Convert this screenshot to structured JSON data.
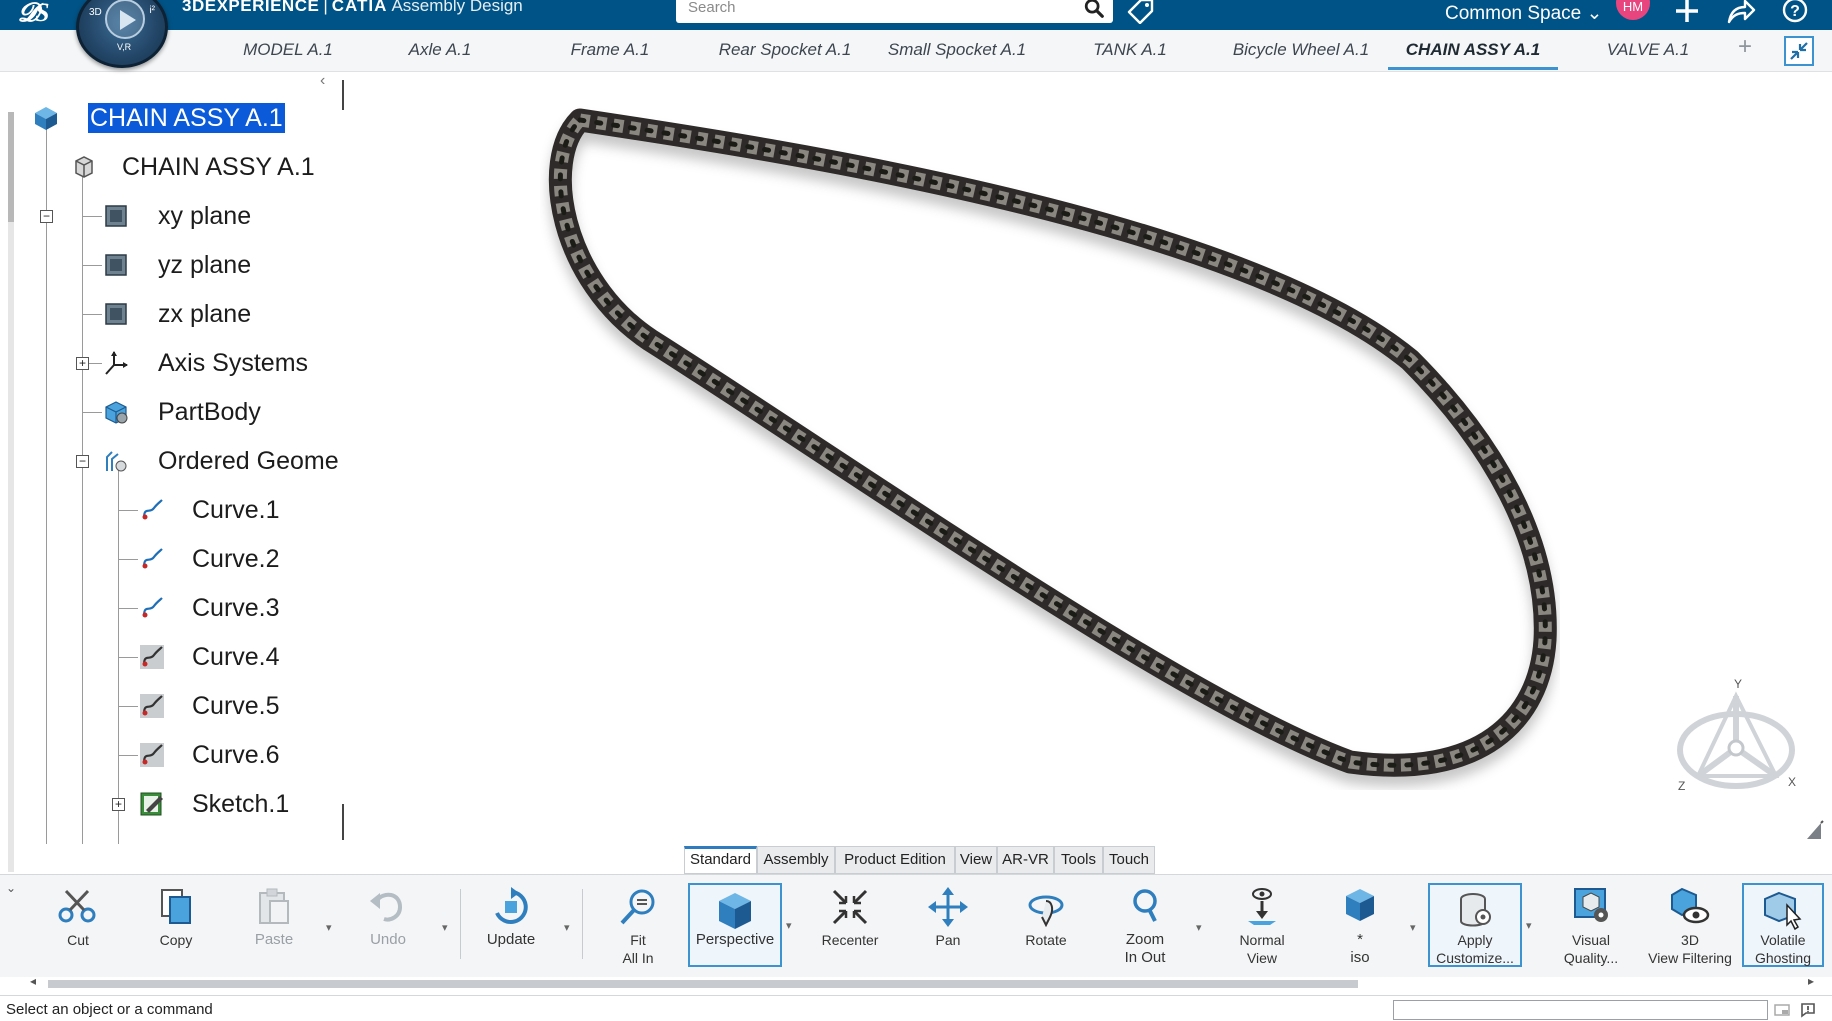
{
  "app": {
    "brand": "3DEXPERIENCE",
    "separator": "|",
    "product": "CATIA",
    "workbench": "Assembly Design",
    "compass_left": "3D",
    "compass_right": "i²",
    "compass_bottom": "V,R"
  },
  "search": {
    "placeholder": "Search"
  },
  "space": {
    "label": "Common Space ⌄"
  },
  "user": {
    "initials": "HM"
  },
  "tabs": [
    {
      "label": "MODEL A.1"
    },
    {
      "label": "Axle A.1"
    },
    {
      "label": "Frame A.1"
    },
    {
      "label": "Rear Spocket A.1"
    },
    {
      "label": "Small Spocket A.1"
    },
    {
      "label": "TANK A.1"
    },
    {
      "label": "Bicycle Wheel A.1"
    },
    {
      "label": "CHAIN ASSY A.1",
      "active": true
    },
    {
      "label": "VALVE A.1"
    }
  ],
  "tree": {
    "root": "CHAIN ASSY A.1",
    "part": "CHAIN ASSY A.1",
    "nodes": [
      {
        "label": "xy plane",
        "icon": "plane-icon"
      },
      {
        "label": "yz plane",
        "icon": "plane-icon"
      },
      {
        "label": "zx plane",
        "icon": "plane-icon"
      },
      {
        "label": "Axis Systems",
        "icon": "axis-system-icon"
      },
      {
        "label": "PartBody",
        "icon": "partbody-icon"
      },
      {
        "label": "Ordered Geome",
        "icon": "geometrical-set-icon"
      },
      {
        "label": "Curve.1",
        "icon": "curve-icon"
      },
      {
        "label": "Curve.2",
        "icon": "curve-icon"
      },
      {
        "label": "Curve.3",
        "icon": "curve-icon"
      },
      {
        "label": "Curve.4",
        "icon": "curve-icon"
      },
      {
        "label": "Curve.5",
        "icon": "curve-icon"
      },
      {
        "label": "Curve.6",
        "icon": "curve-icon"
      },
      {
        "label": "Sketch.1",
        "icon": "sketch-icon"
      }
    ]
  },
  "triad": {
    "y": "Y",
    "x": "X",
    "z": "Z"
  },
  "section_tabs": [
    {
      "label": "Standard",
      "active": true
    },
    {
      "label": "Assembly"
    },
    {
      "label": "Product Edition"
    },
    {
      "label": "View"
    },
    {
      "label": "AR-VR"
    },
    {
      "label": "Tools"
    },
    {
      "label": "Touch"
    }
  ],
  "commands": {
    "cut": "Cut",
    "copy": "Copy",
    "paste": "Paste",
    "undo": "Undo",
    "update": "Update",
    "fit_all_in": {
      "l1": "Fit",
      "l2": "All In"
    },
    "perspective": "Perspective",
    "recenter": "Recenter",
    "pan": "Pan",
    "rotate": "Rotate",
    "zoom": {
      "l1": "Zoom",
      "l2": "In Out"
    },
    "normal_view": {
      "l1": "Normal",
      "l2": "View"
    },
    "iso": {
      "l1": "*",
      "l2": "iso"
    },
    "apply_customize": {
      "l1": "Apply",
      "l2": "Customize..."
    },
    "visual_quality": {
      "l1": "Visual",
      "l2": "Quality..."
    },
    "view_filtering": {
      "l1": "3D",
      "l2": "View Filtering"
    },
    "volatile_ghosting": {
      "l1": "Volatile",
      "l2": "Ghosting"
    }
  },
  "status": {
    "message": "Select an object or a command"
  },
  "colors": {
    "topbar": "#005386",
    "selection": "#0a5ad9",
    "accent": "#3d93d0",
    "avatar": "#e8457f",
    "chain": "#3a3834"
  }
}
